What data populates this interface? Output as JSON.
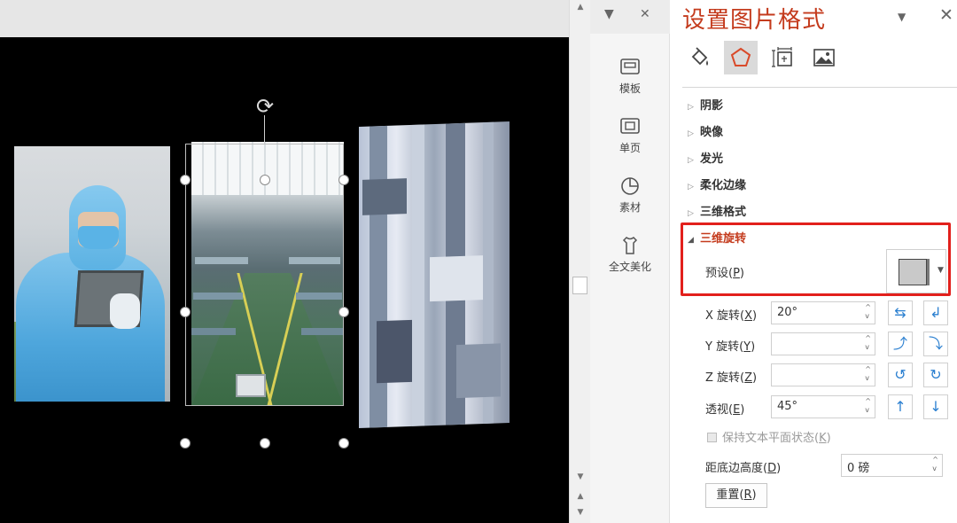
{
  "tools_panel": {
    "pin_glyph": "▼",
    "close_glyph": "✕",
    "items": [
      {
        "label": "模板",
        "icon": "template-icon"
      },
      {
        "label": "单页",
        "icon": "single-page-icon"
      },
      {
        "label": "素材",
        "icon": "material-icon"
      },
      {
        "label": "全文美化",
        "icon": "beautify-icon"
      }
    ]
  },
  "pane": {
    "title": "设置图片格式",
    "dropdown_glyph": "▼",
    "close_glyph": "✕",
    "tabs": [
      {
        "name": "fill-line",
        "icon": "paint-bucket-icon"
      },
      {
        "name": "effects",
        "icon": "pentagon-icon"
      },
      {
        "name": "size-properties",
        "icon": "size-icon"
      },
      {
        "name": "picture",
        "icon": "picture-icon"
      }
    ],
    "sections": [
      {
        "label": "阴影",
        "expanded": false
      },
      {
        "label": "映像",
        "expanded": false
      },
      {
        "label": "发光",
        "expanded": false
      },
      {
        "label": "柔化边缘",
        "expanded": false
      },
      {
        "label": "三维格式",
        "expanded": false
      },
      {
        "label": "三维旋转",
        "expanded": true
      }
    ],
    "rotation": {
      "preset_label": "预设(",
      "preset_key": "P",
      "x_label": "X 旋转(",
      "x_key": "X",
      "x_value": "20°",
      "y_label": "Y 旋转(",
      "y_key": "Y",
      "y_value": "",
      "z_label": "Z 旋转(",
      "z_key": "Z",
      "z_value": "",
      "persp_label": "透视(",
      "persp_key": "E",
      "persp_value": "45°",
      "keep_flat_label": "保持文本平面状态(",
      "keep_flat_key": "K",
      "keep_flat_checked": false,
      "distance_label": "距底边高度(",
      "distance_key": "D",
      "distance_value": "0 磅",
      "reset_label": "重置(",
      "reset_key": "R",
      "close_paren": ")"
    },
    "accent_color": "#C43B1D",
    "highlight_color": "#E2201C"
  },
  "slide": {
    "rotate_glyph": "⟳"
  }
}
